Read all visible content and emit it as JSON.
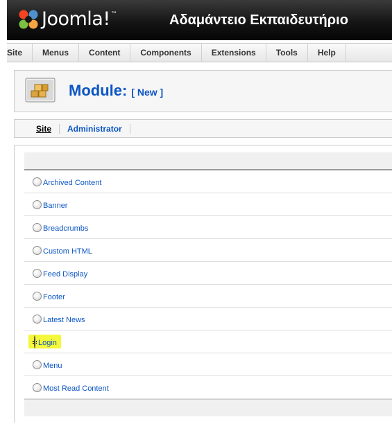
{
  "header": {
    "brand": "Joomla!",
    "brand_tm": "™",
    "site_title": "Αδαμάντειο Εκπαιδευτήριο"
  },
  "menubar": {
    "items": [
      {
        "label": "Site"
      },
      {
        "label": "Menus"
      },
      {
        "label": "Content"
      },
      {
        "label": "Components"
      },
      {
        "label": "Extensions"
      },
      {
        "label": "Tools"
      },
      {
        "label": "Help"
      }
    ]
  },
  "toolbar": {
    "title": "Module:",
    "subtitle": "[ New ]",
    "icon": "module-icon"
  },
  "submenu": {
    "tabs": [
      {
        "label": "Site",
        "active": true
      },
      {
        "label": "Administrator",
        "active": false
      }
    ]
  },
  "modules": {
    "items": [
      {
        "label": "Archived Content",
        "selected": false
      },
      {
        "label": "Banner",
        "selected": false
      },
      {
        "label": "Breadcrumbs",
        "selected": false
      },
      {
        "label": "Custom HTML",
        "selected": false
      },
      {
        "label": "Feed Display",
        "selected": false
      },
      {
        "label": "Footer",
        "selected": false
      },
      {
        "label": "Latest News",
        "selected": false
      },
      {
        "label": "Login",
        "selected": true,
        "highlighted": true
      },
      {
        "label": "Menu",
        "selected": false
      },
      {
        "label": "Most Read Content",
        "selected": false
      }
    ]
  },
  "colors": {
    "link": "#0b55c4",
    "highlight": "#f4f83a",
    "header_bg": "#151515"
  }
}
